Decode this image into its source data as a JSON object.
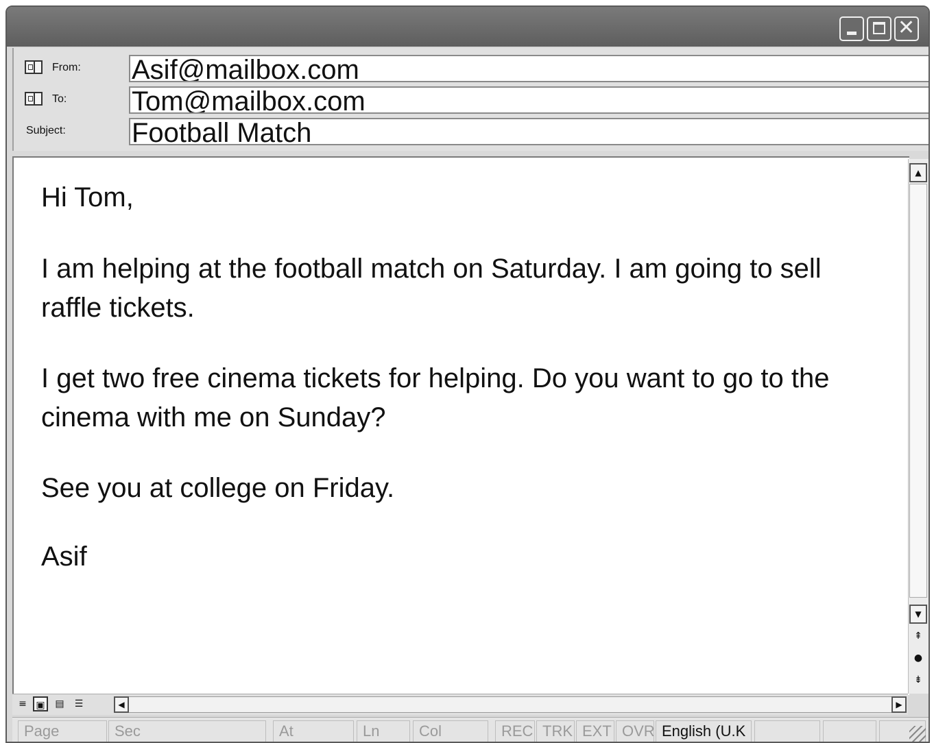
{
  "window": {
    "controls": {
      "minimize": "minimize-icon",
      "maximize": "maximize-icon",
      "close": "close-icon"
    }
  },
  "header": {
    "from_label": "From:",
    "from_value": "Asif@mailbox.com",
    "to_label": "To:",
    "to_value": "Tom@mailbox.com",
    "subject_label": "Subject:",
    "subject_value": "Football Match",
    "address_book_icon": "address-book-icon"
  },
  "body": {
    "greeting": "Hi Tom,",
    "paragraph1": "I am helping at the football match on Saturday. I am going to sell raffle tickets.",
    "paragraph2": "I get two free cinema tickets for helping. Do you want to go to the cinema with me on Sunday?",
    "paragraph3": "See you at college on Friday.",
    "signature": "Asif"
  },
  "statusbar": {
    "page": "Page",
    "sec": "Sec",
    "at": "At",
    "ln": "Ln",
    "col": "Col",
    "rec": "REC",
    "trk": "TRK",
    "ext": "EXT",
    "ovr": "OVR",
    "language": "English (U.K"
  }
}
